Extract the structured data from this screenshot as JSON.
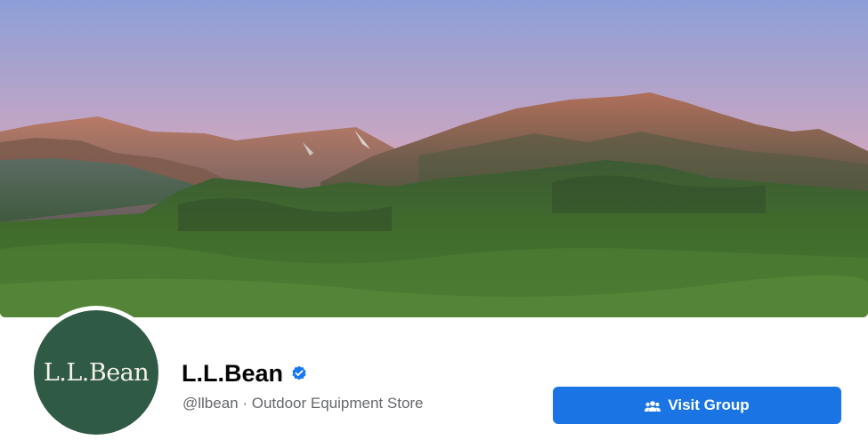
{
  "cover": {
    "description_icon": "mountain-landscape-cover-photo",
    "colors": {
      "sky_top": "#8aa0d6",
      "sky_bottom": "#f2a97a",
      "forest": "#3e6a2a"
    }
  },
  "profile": {
    "logo_text": "L.L.Bean",
    "name": "L.L.Bean",
    "verified_icon": "verified-badge-icon",
    "subtitle": "@llbean · Outdoor Equipment Store",
    "avatar_color": "#2f5a45"
  },
  "actions": {
    "visit_group_label": "Visit Group",
    "visit_group_icon": "group-icon",
    "button_color": "#1b74e4"
  }
}
